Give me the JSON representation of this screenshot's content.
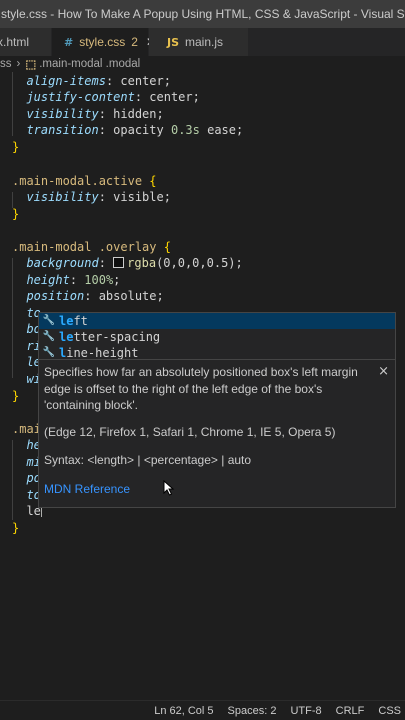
{
  "window": {
    "title": "style.css - How To Make A Popup Using HTML, CSS & JavaScript - Visual Studi..."
  },
  "tabs": [
    {
      "label": "x.html",
      "icon": "html-file-icon"
    },
    {
      "label": "style.css",
      "badge": "2",
      "icon": "css-file-icon",
      "icon_glyph": "#",
      "active": true
    },
    {
      "label": "main.js",
      "icon": "js-file-icon",
      "icon_glyph": "JS"
    }
  ],
  "breadcrumb": {
    "first": "ss",
    "current": ".main-modal .modal"
  },
  "code": {
    "l1_prop": "align-items",
    "l1_val": "center",
    "l2_prop": "justify-content",
    "l2_val": "center",
    "l3_prop": "visibility",
    "l3_val": "hidden",
    "l4_prop": "transition",
    "l4_val1": "opacity",
    "l4_num": "0.3s",
    "l4_val2": "ease",
    "sel_active": ".main-modal.active",
    "l7_prop": "visibility",
    "l7_val": "visible",
    "sel_overlay": ".main-modal .overlay",
    "l10_prop": "background",
    "l10_fn": "rgba",
    "l10_args": "(0,0,0,0.5)",
    "l11_prop": "height",
    "l11_num": "100%",
    "l12_prop": "position",
    "l12_val": "absolute",
    "l13_frag": "to",
    "l14_frag": "bo",
    "l15_frag": "ri",
    "l16_frag": "le",
    "l17_frag": "wi",
    "sel_modal_frag": ".mai",
    "l20_frag": "he",
    "l21_frag": "mi",
    "l22_frag": "po",
    "l23_frag": "to",
    "l24_typed": "le",
    "open_brace": "{",
    "close_brace": "}"
  },
  "suggestions": [
    {
      "match": "le",
      "rest": "ft",
      "icon": "wrench-icon"
    },
    {
      "match": "le",
      "rest": "tter-spacing",
      "icon": "wrench-icon"
    },
    {
      "match": "l",
      "rest": "ine-height",
      "icon": "wrench-icon"
    }
  ],
  "detail": {
    "description": "Specifies how far an absolutely positioned box's left margin edge is offset to the right of the left edge of the box's 'containing block'.",
    "compat": "(Edge 12, Firefox 1, Safari 1, Chrome 1, IE 5, Opera 5)",
    "syntax": "Syntax: <length> | <percentage> | auto",
    "link": "MDN Reference",
    "close": "×"
  },
  "status": {
    "position": "Ln 62, Col 5",
    "spaces": "Spaces: 2",
    "encoding": "UTF-8",
    "eol": "CRLF",
    "language": "CSS"
  },
  "colors": {
    "property": "#9cdcfe",
    "selector": "#d7ba7d",
    "number": "#b5cea8",
    "function": "#dcdcaa",
    "brace": "#ffd700",
    "link": "#3794ff"
  }
}
